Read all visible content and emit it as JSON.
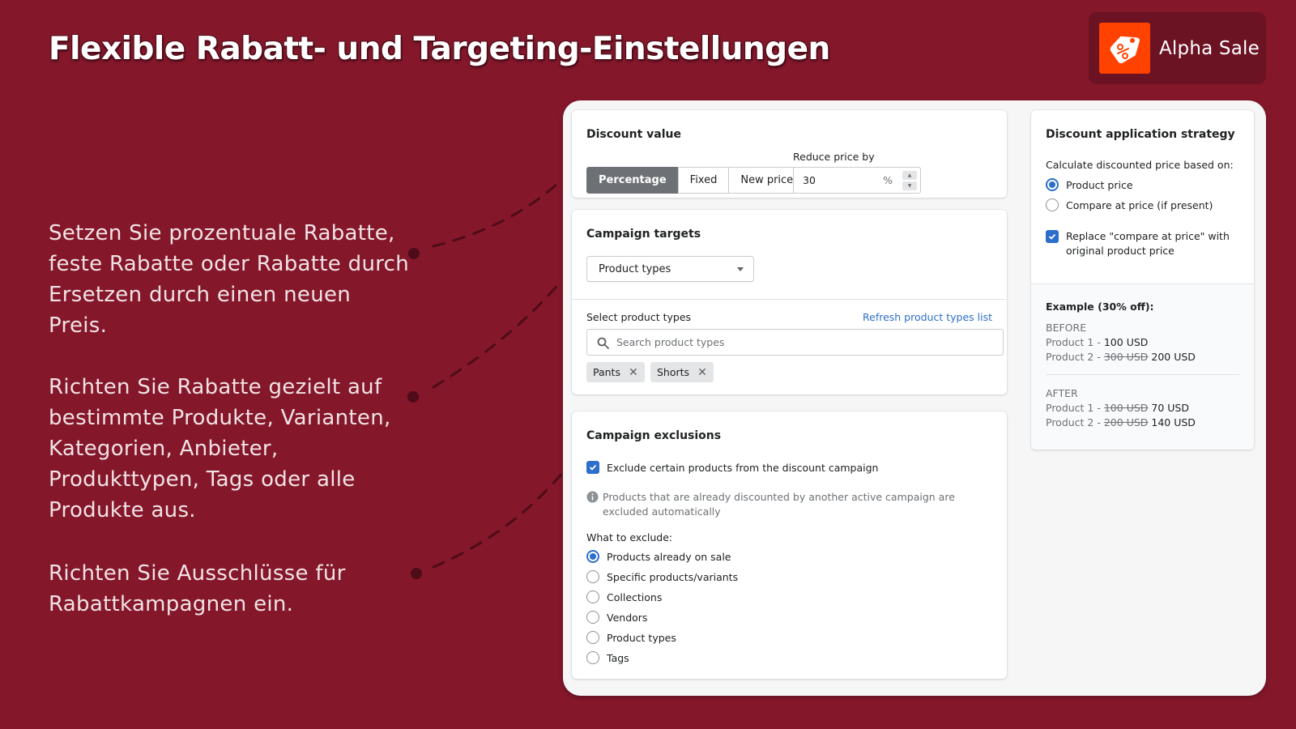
{
  "page": {
    "title": "Flexible Rabatt- und Targeting-Einstellungen"
  },
  "brand": {
    "name": "Alpha Sale",
    "logo_icon": "price-tag-percent-icon",
    "logo_color": "#ff4200"
  },
  "colors": {
    "background": "#85172b",
    "connector": "#4e0c18",
    "accent": "#2c6ecb"
  },
  "features": [
    {
      "text": "Setzen Sie prozentuale Rabatte, feste Rabatte oder Rabatte durch Ersetzen durch einen neuen Preis."
    },
    {
      "text": "Richten Sie Rabatte gezielt auf bestimmte Produkte, Varianten, Kategorien, Anbieter, Produkttypen, Tags oder alle Produkte aus."
    },
    {
      "text": "Richten Sie Ausschlüsse für Rabattkampagnen ein."
    }
  ],
  "discount_value": {
    "title": "Discount value",
    "types": [
      {
        "label": "Percentage",
        "active": true
      },
      {
        "label": "Fixed",
        "active": false
      },
      {
        "label": "New price",
        "active": false
      }
    ],
    "reduce_label": "Reduce price by",
    "reduce_value": "30",
    "reduce_suffix": "%"
  },
  "campaign_targets": {
    "title": "Campaign targets",
    "select_value": "Product types",
    "select_label": "Select product types",
    "refresh_link": "Refresh product types list",
    "search_placeholder": "Search product types",
    "tags": [
      "Pants",
      "Shorts"
    ]
  },
  "campaign_exclusions": {
    "title": "Campaign exclusions",
    "exclude_checkbox_label": "Exclude certain products from the discount campaign",
    "exclude_checked": true,
    "info_text": "Products that are already discounted by another active campaign are excluded automatically",
    "what_label": "What to exclude:",
    "options": [
      {
        "label": "Products already on sale",
        "selected": true
      },
      {
        "label": "Specific products/variants",
        "selected": false
      },
      {
        "label": "Collections",
        "selected": false
      },
      {
        "label": "Vendors",
        "selected": false
      },
      {
        "label": "Product types",
        "selected": false
      },
      {
        "label": "Tags",
        "selected": false
      }
    ]
  },
  "strategy": {
    "title": "Discount application strategy",
    "calc_label": "Calculate discounted price based on:",
    "options": [
      {
        "label": "Product price",
        "selected": true
      },
      {
        "label": "Compare at price (if present)",
        "selected": false
      }
    ],
    "replace_label": "Replace \"compare at price\" with original product price",
    "replace_checked": true,
    "example": {
      "title": "Example (30% off):",
      "before_label": "BEFORE",
      "before": [
        {
          "prefix": "Product 1 - ",
          "old": "",
          "new": "100 USD"
        },
        {
          "prefix": "Product 2 - ",
          "old": "300 USD",
          "new": "200 USD"
        }
      ],
      "after_label": "AFTER",
      "after": [
        {
          "prefix": "Product 1 - ",
          "old": "100 USD",
          "new": "70 USD"
        },
        {
          "prefix": "Product 2 - ",
          "old": "200 USD",
          "new": "140 USD"
        }
      ]
    }
  }
}
